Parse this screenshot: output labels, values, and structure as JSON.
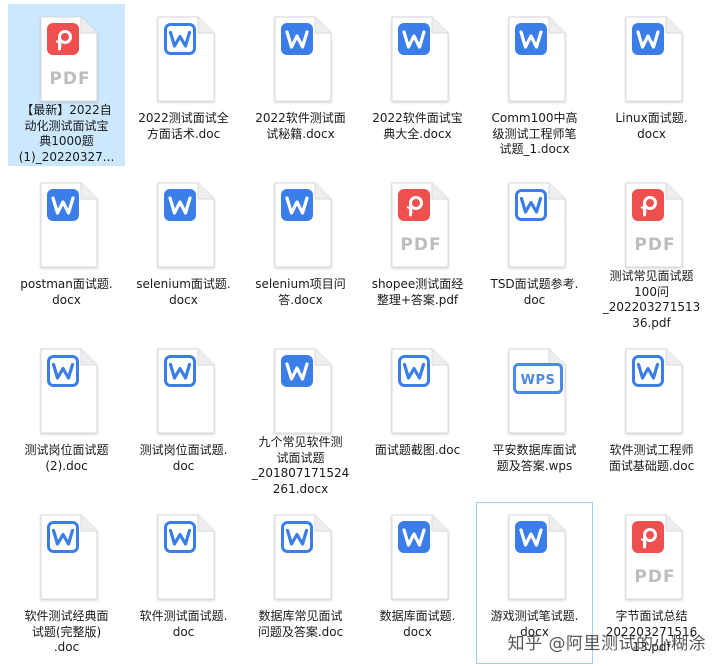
{
  "colors": {
    "word": "#3b7de9",
    "pdf": "#ee4f4f",
    "wps": "#4a8ae6",
    "selection": "#cce8ff"
  },
  "files": [
    {
      "name": "【最新】2022自动化测试面试宝典1000题(1)_20220327...",
      "type": "pdf",
      "selected": true
    },
    {
      "name": "2022测试面试全方面话术.doc",
      "type": "doc"
    },
    {
      "name": "2022软件测试面试秘籍.docx",
      "type": "docx"
    },
    {
      "name": "2022软件面试宝典大全.docx",
      "type": "docx"
    },
    {
      "name": "Comm100中高级测试工程师笔试题_1.docx",
      "type": "docx"
    },
    {
      "name": "Linux面试题.docx",
      "type": "docx"
    },
    {
      "name": "postman面试题.docx",
      "type": "docx"
    },
    {
      "name": "selenium面试题.docx",
      "type": "docx"
    },
    {
      "name": "selenium项目问答.docx",
      "type": "docx"
    },
    {
      "name": "shopee测试面经整理+答案.pdf",
      "type": "pdf"
    },
    {
      "name": "TSD面试题参考.doc",
      "type": "doc"
    },
    {
      "name": "测试常见面试题100问_20220327151336.pdf",
      "type": "pdf"
    },
    {
      "name": "测试岗位面试题(2).doc",
      "type": "doc"
    },
    {
      "name": "测试岗位面试题.doc",
      "type": "doc"
    },
    {
      "name": "九个常见软件测试面试题_20180717152426 1.docx",
      "type": "docx"
    },
    {
      "name": "面试题截图.doc",
      "type": "doc"
    },
    {
      "name": "平安数据库面试题及答案.wps",
      "type": "wps"
    },
    {
      "name": "软件测试工程师面试基础题.doc",
      "type": "doc"
    },
    {
      "name": "软件测试经典面试题(完整版).doc",
      "type": "doc"
    },
    {
      "name": "软件测试面试题.doc",
      "type": "doc"
    },
    {
      "name": "数据库常见面试问题及答案.doc",
      "type": "doc"
    },
    {
      "name": "数据库面试题.docx",
      "type": "docx"
    },
    {
      "name": "游戏测试笔试题.docx",
      "type": "docx",
      "hovered": true
    },
    {
      "name": "字节面试总结20220327151613.pdf",
      "type": "pdf"
    }
  ],
  "watermark": "知乎 @阿里测试的小糊涂"
}
